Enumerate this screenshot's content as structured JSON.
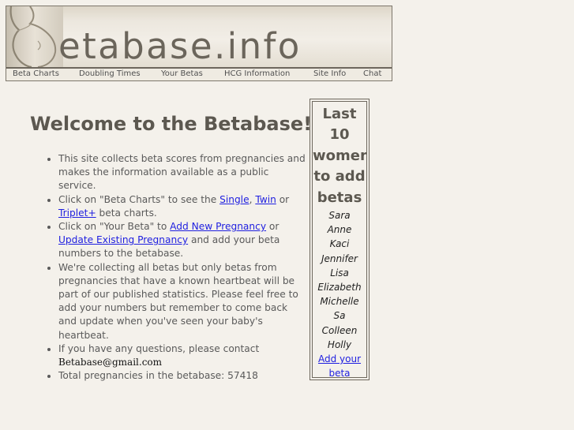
{
  "header": {
    "logo_text": "etabase.info"
  },
  "nav": [
    {
      "label": "Beta Charts"
    },
    {
      "label": "Doubling Times"
    },
    {
      "label": "Your Betas"
    },
    {
      "label": "HCG Information"
    },
    {
      "label": "Site Info"
    },
    {
      "label": "Chat"
    }
  ],
  "main": {
    "title": "Welcome to the Betabase!",
    "bullet1": "This site collects beta scores from pregnancies and makes the information available as a public service.",
    "bullet2": {
      "before": "Click on \"Beta Charts\" to see the ",
      "link_single": "Single",
      "sep1": ", ",
      "link_twin": "Twin",
      "sep2": " or ",
      "link_triplet": "Triplet+",
      "after": " beta charts."
    },
    "bullet3": {
      "before": "Click on \"Your Beta\" to ",
      "link_add": "Add New Pregnancy",
      "mid": " or ",
      "link_update": "Update Existing Pregnancy",
      "after": " and add your beta numbers to the betabase."
    },
    "bullet4": "We're collecting all betas but only betas from pregnancies that have a known heartbeat will be part of our published statistics. Please feel free to add your numbers but remember to come back and update when you've seen your baby's heartbeat.",
    "bullet5": {
      "text": "If you have any questions, please contact",
      "email": "Betabase@gmail.com"
    },
    "bullet6": "Total pregnancies in the betabase: 57418"
  },
  "sidebar": {
    "heading": "Last 10 women to add betas",
    "women": [
      "Sara",
      "Anne",
      "Kaci",
      "Jennifer",
      "Lisa",
      "Elizabeth",
      "Michelle",
      "Sa",
      "Colleen",
      "Holly"
    ],
    "add_link": "Add your beta"
  }
}
